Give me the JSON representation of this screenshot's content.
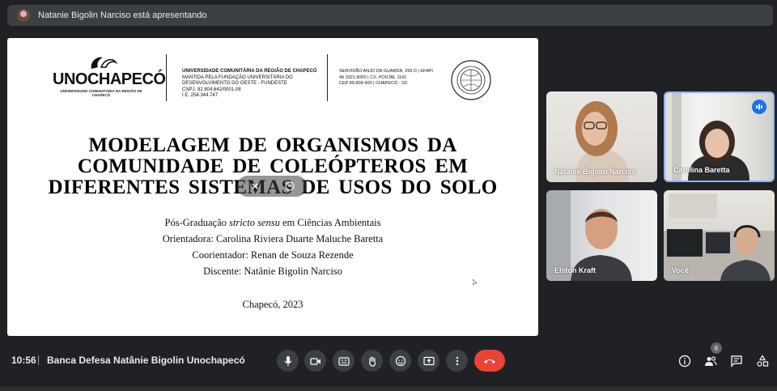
{
  "banner": {
    "presenter_text": "Natanie Bigolin Narciso está apresentando"
  },
  "slide": {
    "logo": {
      "word": "UNOCHAPECÓ",
      "subtitle": "UNIVERSIDADE COMUNITÁRIA DA REGIÃO DE CHAPECÓ"
    },
    "institution": {
      "line1": "UNIVERSIDADE COMUNITÁRIA DA REGIÃO DE CHAPECÓ",
      "line2": "MANTIDA PELA FUNDAÇÃO UNIVERSITÁRIA DO",
      "line3": "DESENVOLVIMENTO DO OESTE - FUNDESTE",
      "line4": "CNPJ. 82.804.642/0001-08",
      "line5": "I.E. 254.344.747"
    },
    "address": {
      "line1": "SERVIDÃO ANJO DA GUARDA, 295 D | EFAPI",
      "line2": "49 3321.8000 | CX. POSTAL 1141",
      "line3": "CEP 89.809-900 | CHAPECÓ - SC"
    },
    "title": {
      "line1": "MODELAGEM DE ORGANISMOS DA",
      "line2": "COMUNIDADE DE COLEÓPTEROS EM",
      "line3": "DIFERENTES SISTEMAS DE USOS DO SOLO"
    },
    "program_prefix": "Pós-Graduação ",
    "program_italic": "stricto sensu",
    "program_suffix": " em Ciências Ambientais",
    "advisor": "Orientadora: Carolina Riviera Duarte Maluche Baretta",
    "coadvisor": "Coorientador: Renan de Souza Rezende",
    "student": "Discente: Natânie Bigolin Narciso",
    "city_year": "Chapecó, 2023"
  },
  "participants": [
    {
      "name": "Natanie Bigolin Narciso"
    },
    {
      "name": "Carolina Baretta"
    },
    {
      "name": "Elston Kraft"
    },
    {
      "name": "Você"
    }
  ],
  "bottom_bar": {
    "time": "10:56",
    "separator": "|",
    "meeting_name": "Banca Defesa Natânie Bigolin Unochapecó",
    "people_count": "6"
  },
  "colors": {
    "end_call": "#ea4335",
    "speaking": "#1a73e8",
    "control_bg": "#3c4043"
  }
}
